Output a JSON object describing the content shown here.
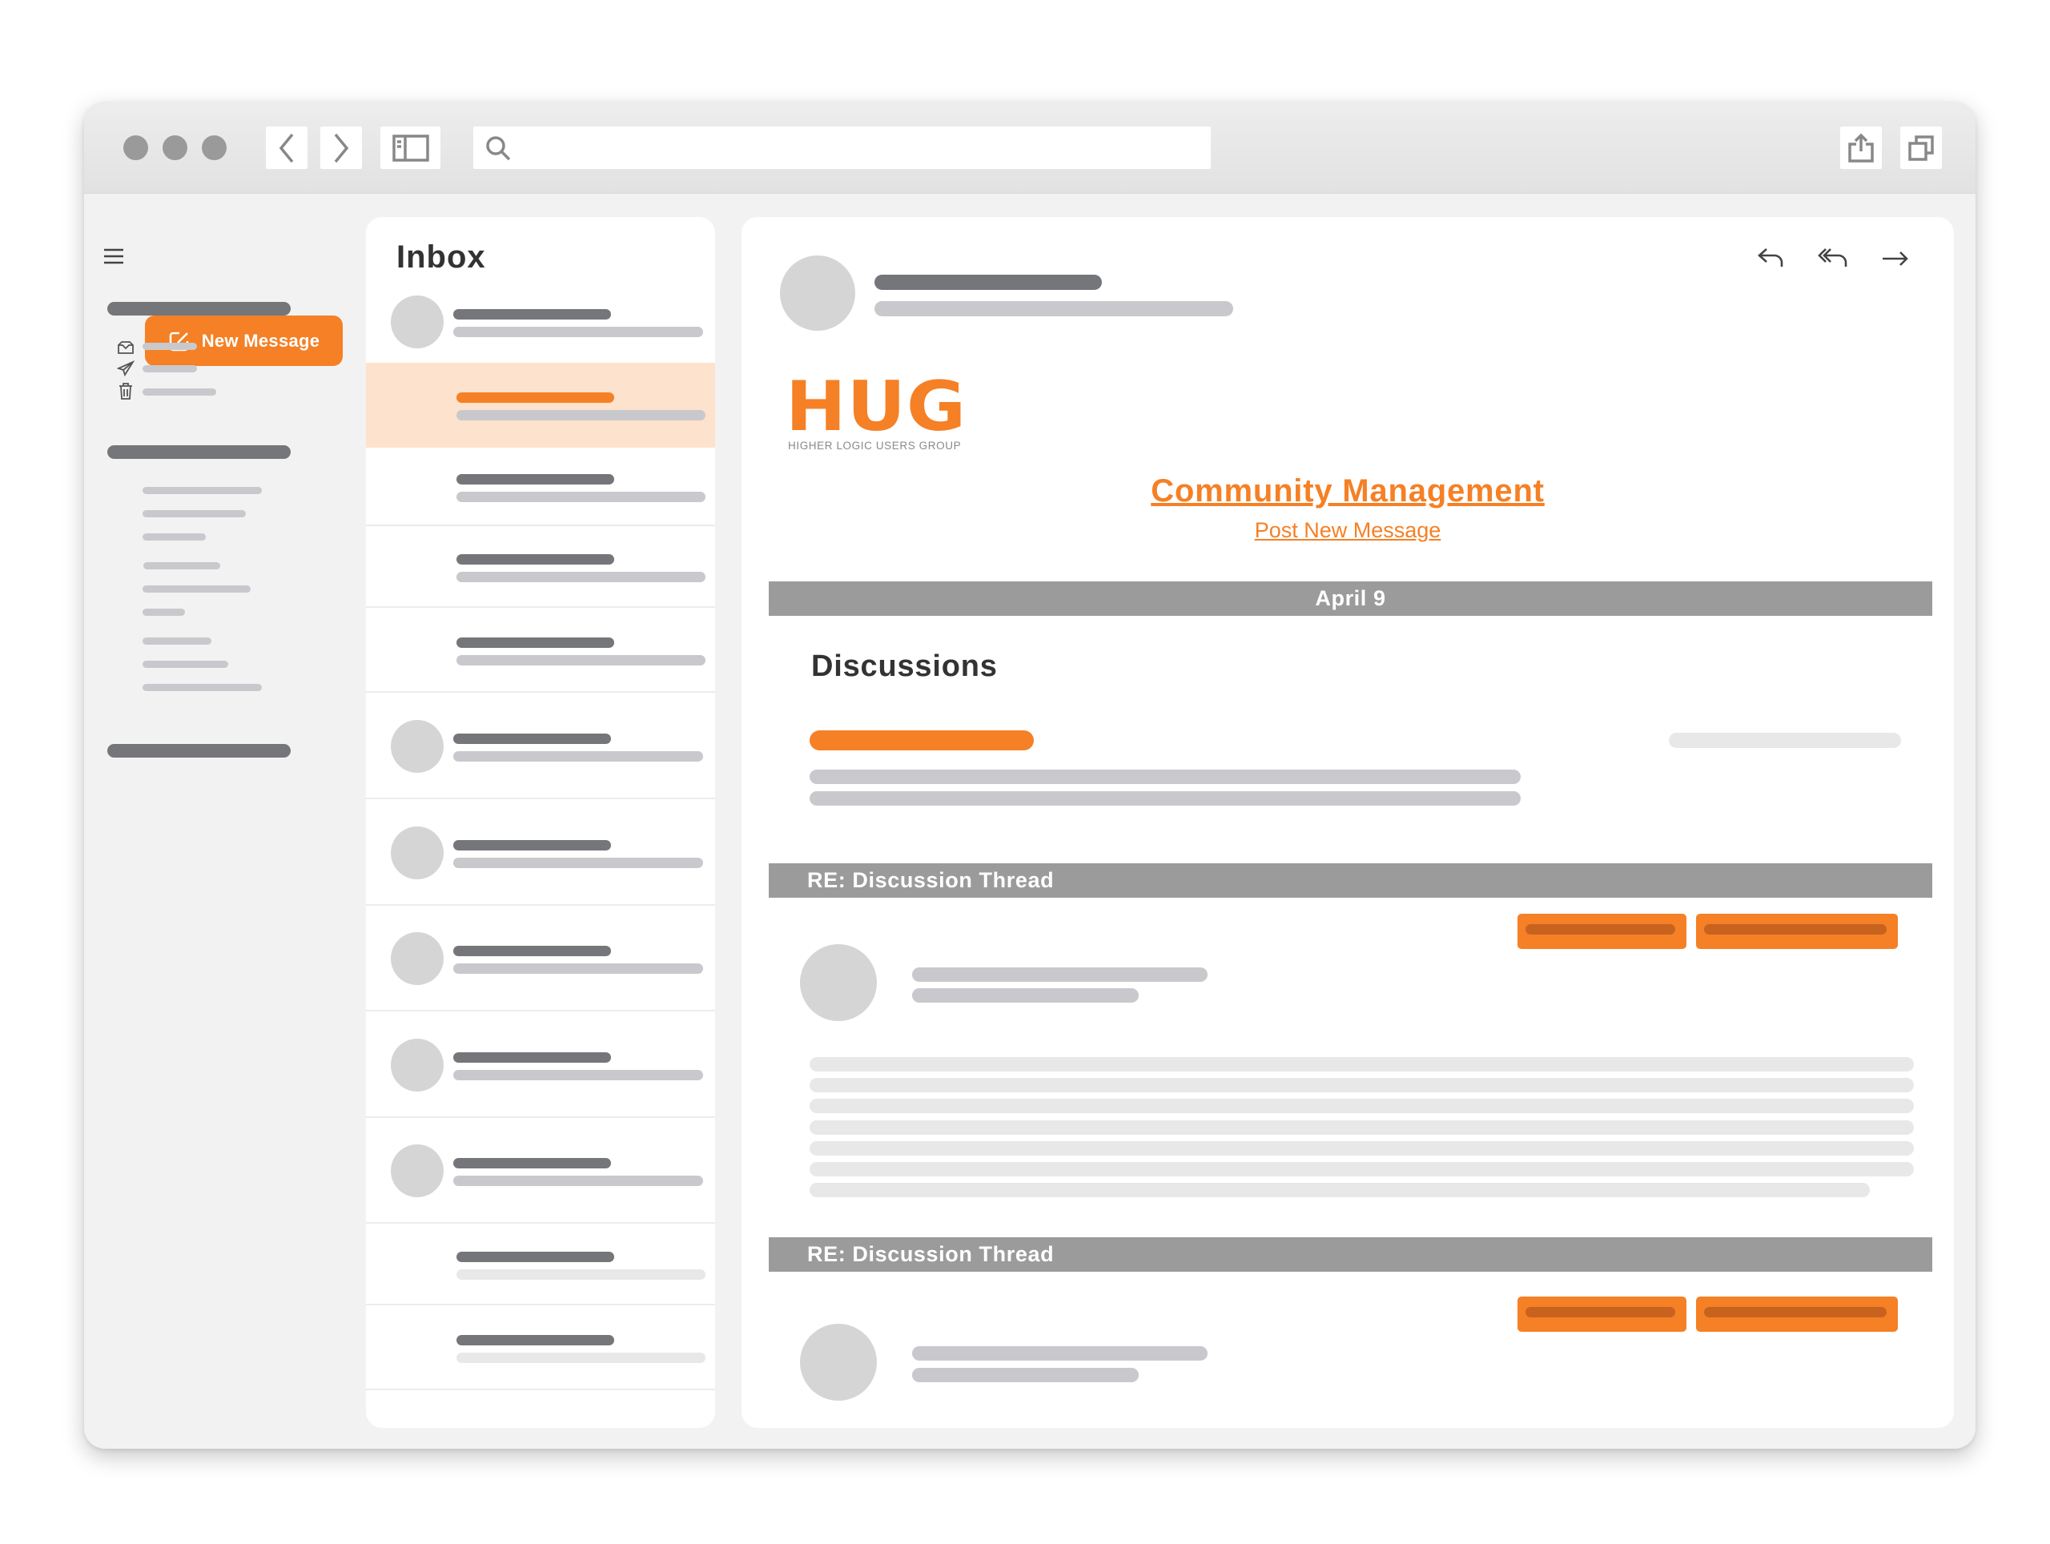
{
  "browser": {
    "traffic_lights": [
      "close",
      "minimize",
      "zoom"
    ],
    "toolbar_icons": {
      "back": "chevron-left-icon",
      "forward": "chevron-right-icon",
      "sidebar_toggle": "sidebar-icon",
      "search": "search-icon",
      "share": "share-icon",
      "tabs": "tabs-icon"
    },
    "address_value": ""
  },
  "sidebar": {
    "menu_icon": "hamburger-icon",
    "new_message_label": "New Message",
    "mailbox_icons": [
      "inbox-icon",
      "sent-icon",
      "trash-icon"
    ]
  },
  "inbox": {
    "title": "Inbox",
    "selected_index": 1
  },
  "message": {
    "actions": [
      "reply-icon",
      "reply-all-icon",
      "forward-icon"
    ],
    "logo": {
      "mark": "HUG",
      "tagline": "HIGHER LOGIC USERS GROUP"
    },
    "community_title": "Community Management",
    "post_link": "Post New Message",
    "date_header": "April 9",
    "discussions_heading": "Discussions",
    "threads": [
      {
        "title": "RE: Discussion Thread"
      },
      {
        "title": "RE: Discussion Thread"
      }
    ]
  },
  "colors": {
    "accent": "#f58025",
    "selected_row": "#fde2cd",
    "section_bar": "#9b9b9b",
    "placeholder_dark": "#75767a",
    "placeholder_light": "#c9c9cd"
  }
}
